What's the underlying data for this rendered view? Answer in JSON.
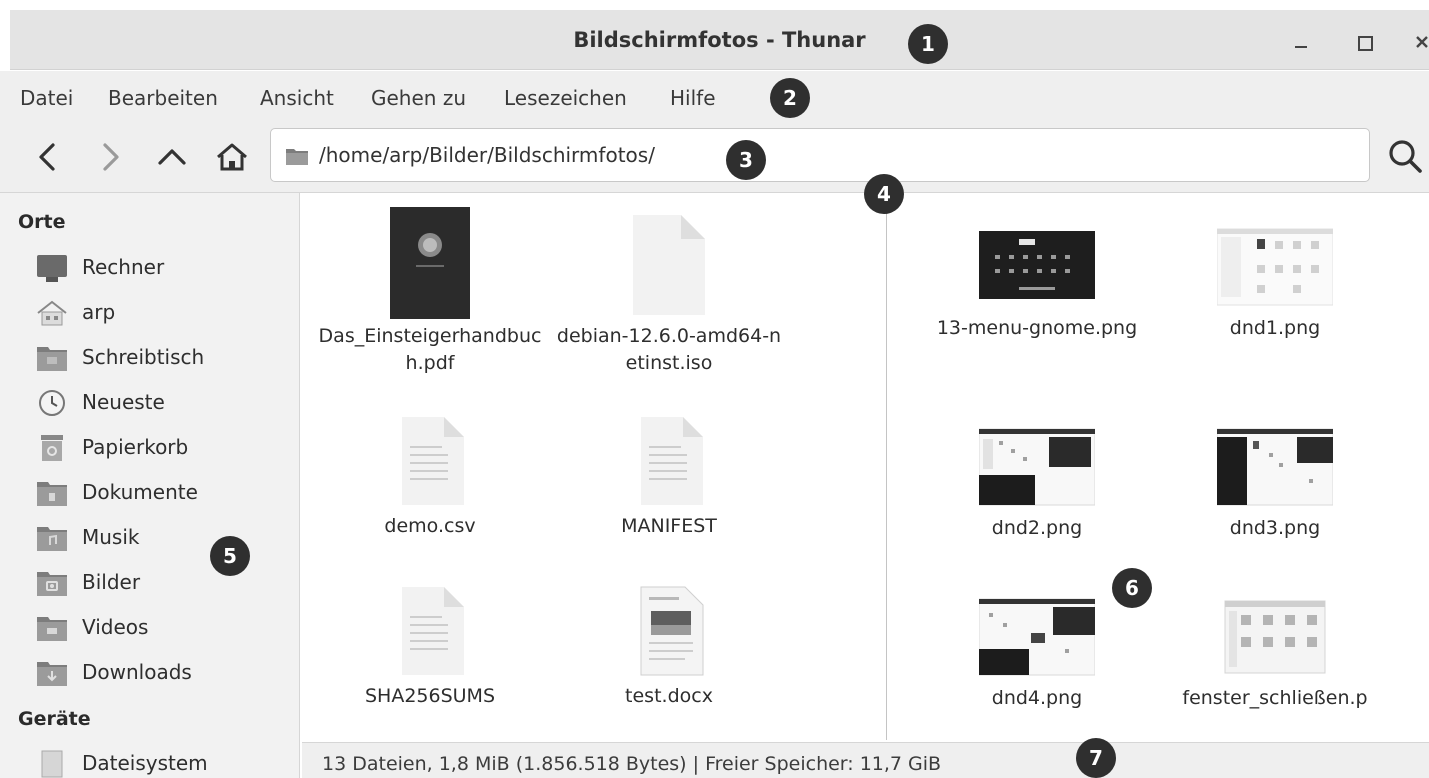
{
  "window": {
    "title": "Bildschirmfotos - Thunar",
    "controls": [
      "minimize-icon",
      "maximize-icon",
      "close-icon"
    ]
  },
  "menubar": {
    "items": [
      "Datei",
      "Bearbeiten",
      "Ansicht",
      "Gehen zu",
      "Lesezeichen",
      "Hilfe"
    ]
  },
  "toolbar": {
    "buttons": [
      "back-icon",
      "forward-icon",
      "up-icon",
      "home-icon"
    ],
    "path": "/home/arp/Bilder/Bildschirmfotos/",
    "search_icon": "search-icon"
  },
  "sidebar": {
    "places_title": "Orte",
    "places": [
      "Rechner",
      "arp",
      "Schreibtisch",
      "Neueste",
      "Papierkorb",
      "Dokumente",
      "Musik",
      "Bilder",
      "Videos",
      "Downloads"
    ],
    "devices_title": "Geräte",
    "devices": [
      "Dateisystem"
    ]
  },
  "left_pane": {
    "files": [
      {
        "name": "Das_Einsteigerhandbuch.pdf",
        "icon": "pdf-thumbnail"
      },
      {
        "name": "debian-12.6.0-amd64-netinst.iso",
        "icon": "blank-file-icon"
      },
      {
        "name": "demo.csv",
        "icon": "text-file-icon"
      },
      {
        "name": "MANIFEST",
        "icon": "text-file-icon"
      },
      {
        "name": "SHA256SUMS",
        "icon": "text-file-icon"
      },
      {
        "name": "test.docx",
        "icon": "document-thumbnail"
      }
    ]
  },
  "right_pane": {
    "files": [
      {
        "name": "13-menu-gnome.png",
        "icon": "dark-screenshot-thumbnail"
      },
      {
        "name": "dnd1.png",
        "icon": "screenshot-thumbnail"
      },
      {
        "name": "dnd2.png",
        "icon": "screenshot-thumbnail"
      },
      {
        "name": "dnd3.png",
        "icon": "screenshot-thumbnail"
      },
      {
        "name": "dnd4.png",
        "icon": "screenshot-thumbnail"
      },
      {
        "name": "fenster_schließen.p",
        "icon": "screenshot-thumbnail"
      }
    ]
  },
  "statusbar": {
    "text": "13 Dateien, 1,8 MiB (1.856.518 Bytes) | Freier Speicher: 11,7 GiB"
  },
  "callouts": [
    "1",
    "2",
    "3",
    "4",
    "5",
    "6",
    "7"
  ],
  "colors": {
    "chrome": "#efefef",
    "titlebar": "#e4e4e4",
    "callout": "#2f2f2f",
    "folder": "#7d7d7d"
  }
}
